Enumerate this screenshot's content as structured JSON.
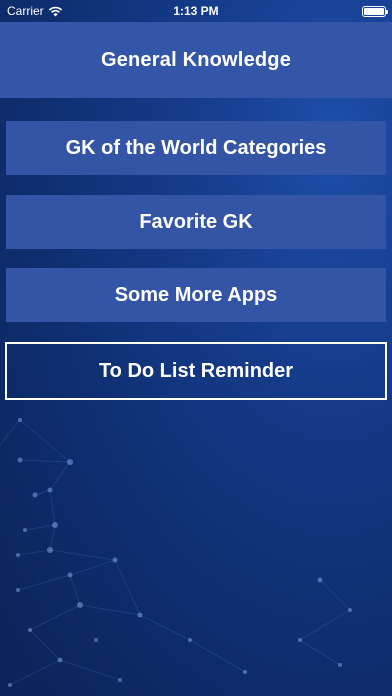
{
  "status_bar": {
    "carrier": "Carrier",
    "time": "1:13 PM"
  },
  "header": {
    "title": "General Knowledge"
  },
  "menu": {
    "items": [
      {
        "label": "GK of the World Categories"
      },
      {
        "label": "Favorite GK"
      },
      {
        "label": "Some More Apps"
      },
      {
        "label": "To Do List Reminder"
      }
    ]
  },
  "colors": {
    "header_bg": "#3356a8",
    "button_bg": "#3454a5",
    "background_dark": "#0b2358",
    "background_light": "#1e4ea8",
    "text": "#ffffff"
  }
}
